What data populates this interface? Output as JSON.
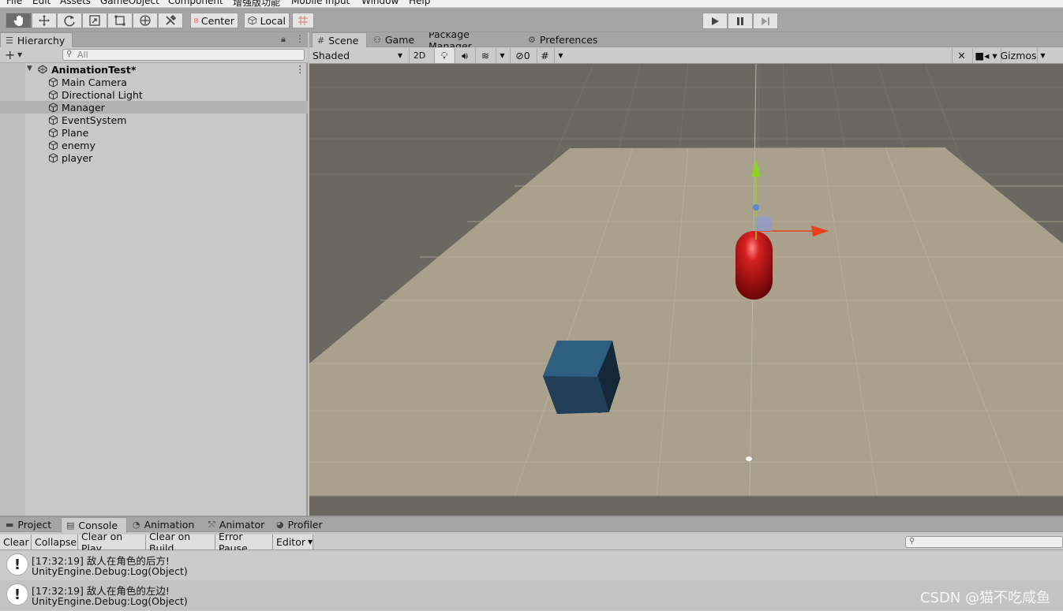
{
  "menu": [
    "File",
    "Edit",
    "Assets",
    "GameObject",
    "Component",
    "增强版功能",
    "Mobile Input",
    "Window",
    "Help"
  ],
  "toolbar": {
    "tools": [
      "hand-tool",
      "move-tool",
      "rotate-tool",
      "scale-tool",
      "rect-tool",
      "transform-tool",
      "custom-tool"
    ],
    "pivot_label": "Center",
    "space_label": "Local"
  },
  "hierarchy": {
    "tab_label": "Hierarchy",
    "search_placeholder": "All",
    "scene_name": "AnimationTest*",
    "items": [
      "Main Camera",
      "Directional Light",
      "Manager",
      "EventSystem",
      "Plane",
      "enemy",
      "player"
    ],
    "selected_index": 2
  },
  "scene_tabs": [
    "Scene",
    "Game",
    "Package Manager",
    "Preferences"
  ],
  "scene_toolbar": {
    "draw_mode": "Shaded",
    "mode_2d": "2D",
    "hidden_count": "0",
    "gizmos_label": "Gizmos"
  },
  "bottom_tabs": [
    "Project",
    "Console",
    "Animation",
    "Animator",
    "Profiler"
  ],
  "console": {
    "buttons": [
      "Clear",
      "Collapse",
      "Clear on Play",
      "Clear on Build",
      "Error Pause",
      "Editor"
    ],
    "logs": [
      {
        "line1": "[17:32:19] 敌人在角色的后方!",
        "line2": "UnityEngine.Debug:Log(Object)"
      },
      {
        "line1": "[17:32:19] 敌人在角色的左边!",
        "line2": "UnityEngine.Debug:Log(Object)"
      }
    ]
  },
  "watermark": "CSDN @猫不吃咸鱼",
  "colors": {
    "ground": "#a8a08a",
    "sky": "#6b6761",
    "capsule": "#c21818",
    "cube": "#2b5878",
    "y_axis": "#8ed321",
    "x_axis": "#e8401c"
  }
}
